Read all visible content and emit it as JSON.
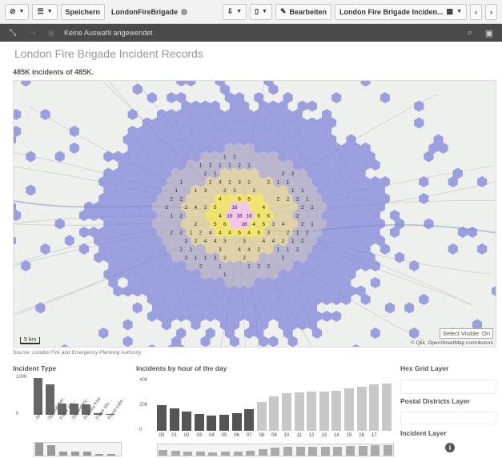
{
  "toolbar": {
    "save_label": "Speichern",
    "app_name": "LondonFireBrigade",
    "edit_label": "Bearbeiten",
    "sheet_name": "London Fire Brigade Inciden..."
  },
  "selections": {
    "status": "Keine Auswahl angewendet"
  },
  "sheet": {
    "title": "London Fire Brigade Incident Records",
    "kpi": "485K incidents of 485K."
  },
  "map": {
    "select_visible": "Select Visible: On",
    "attribution": "© Qlik, OpenStreetMap contributors",
    "scale_label": "5 km",
    "source": "Source: London Fire and Emergency Planning Authority",
    "hex_labels": [
      "1",
      "2",
      "3",
      "4",
      "5",
      "6",
      "16"
    ]
  },
  "incident_type": {
    "title": "Incident Type",
    "y_ticks": [
      "100K",
      "0"
    ],
    "categories": [
      "AFA",
      "Special Ser...",
      "False ala...",
      "Secondary...",
      "Primary Fire",
      "False ala...",
      "Flood calls..."
    ],
    "values": [
      72,
      60,
      22,
      22,
      21,
      3,
      2
    ]
  },
  "by_hour": {
    "title": "Incidents by hour of the day",
    "y_ticks": [
      "40K",
      "20K",
      "0"
    ],
    "hours": [
      "00",
      "01",
      "02",
      "03",
      "04",
      "05",
      "06",
      "07",
      "08",
      "09",
      "10",
      "11",
      "12",
      "13",
      "14",
      "15",
      "16",
      "17"
    ],
    "values": [
      0.52,
      0.45,
      0.39,
      0.34,
      0.3,
      0.33,
      0.36,
      0.43,
      0.58,
      0.7,
      0.76,
      0.78,
      0.79,
      0.79,
      0.81,
      0.85,
      0.89,
      0.93,
      0.95
    ],
    "colors": {
      "dark": "#555555",
      "light": "#c8c8c8"
    }
  },
  "layers": {
    "hex_grid": "Hex Grid Layer",
    "postal": "Postal Districts Layer",
    "incident": "Incident Layer"
  },
  "colors": {
    "hex_fill": "#7b7fd8",
    "hot": "#f3c3ee",
    "accent": "#f1ea5e"
  }
}
